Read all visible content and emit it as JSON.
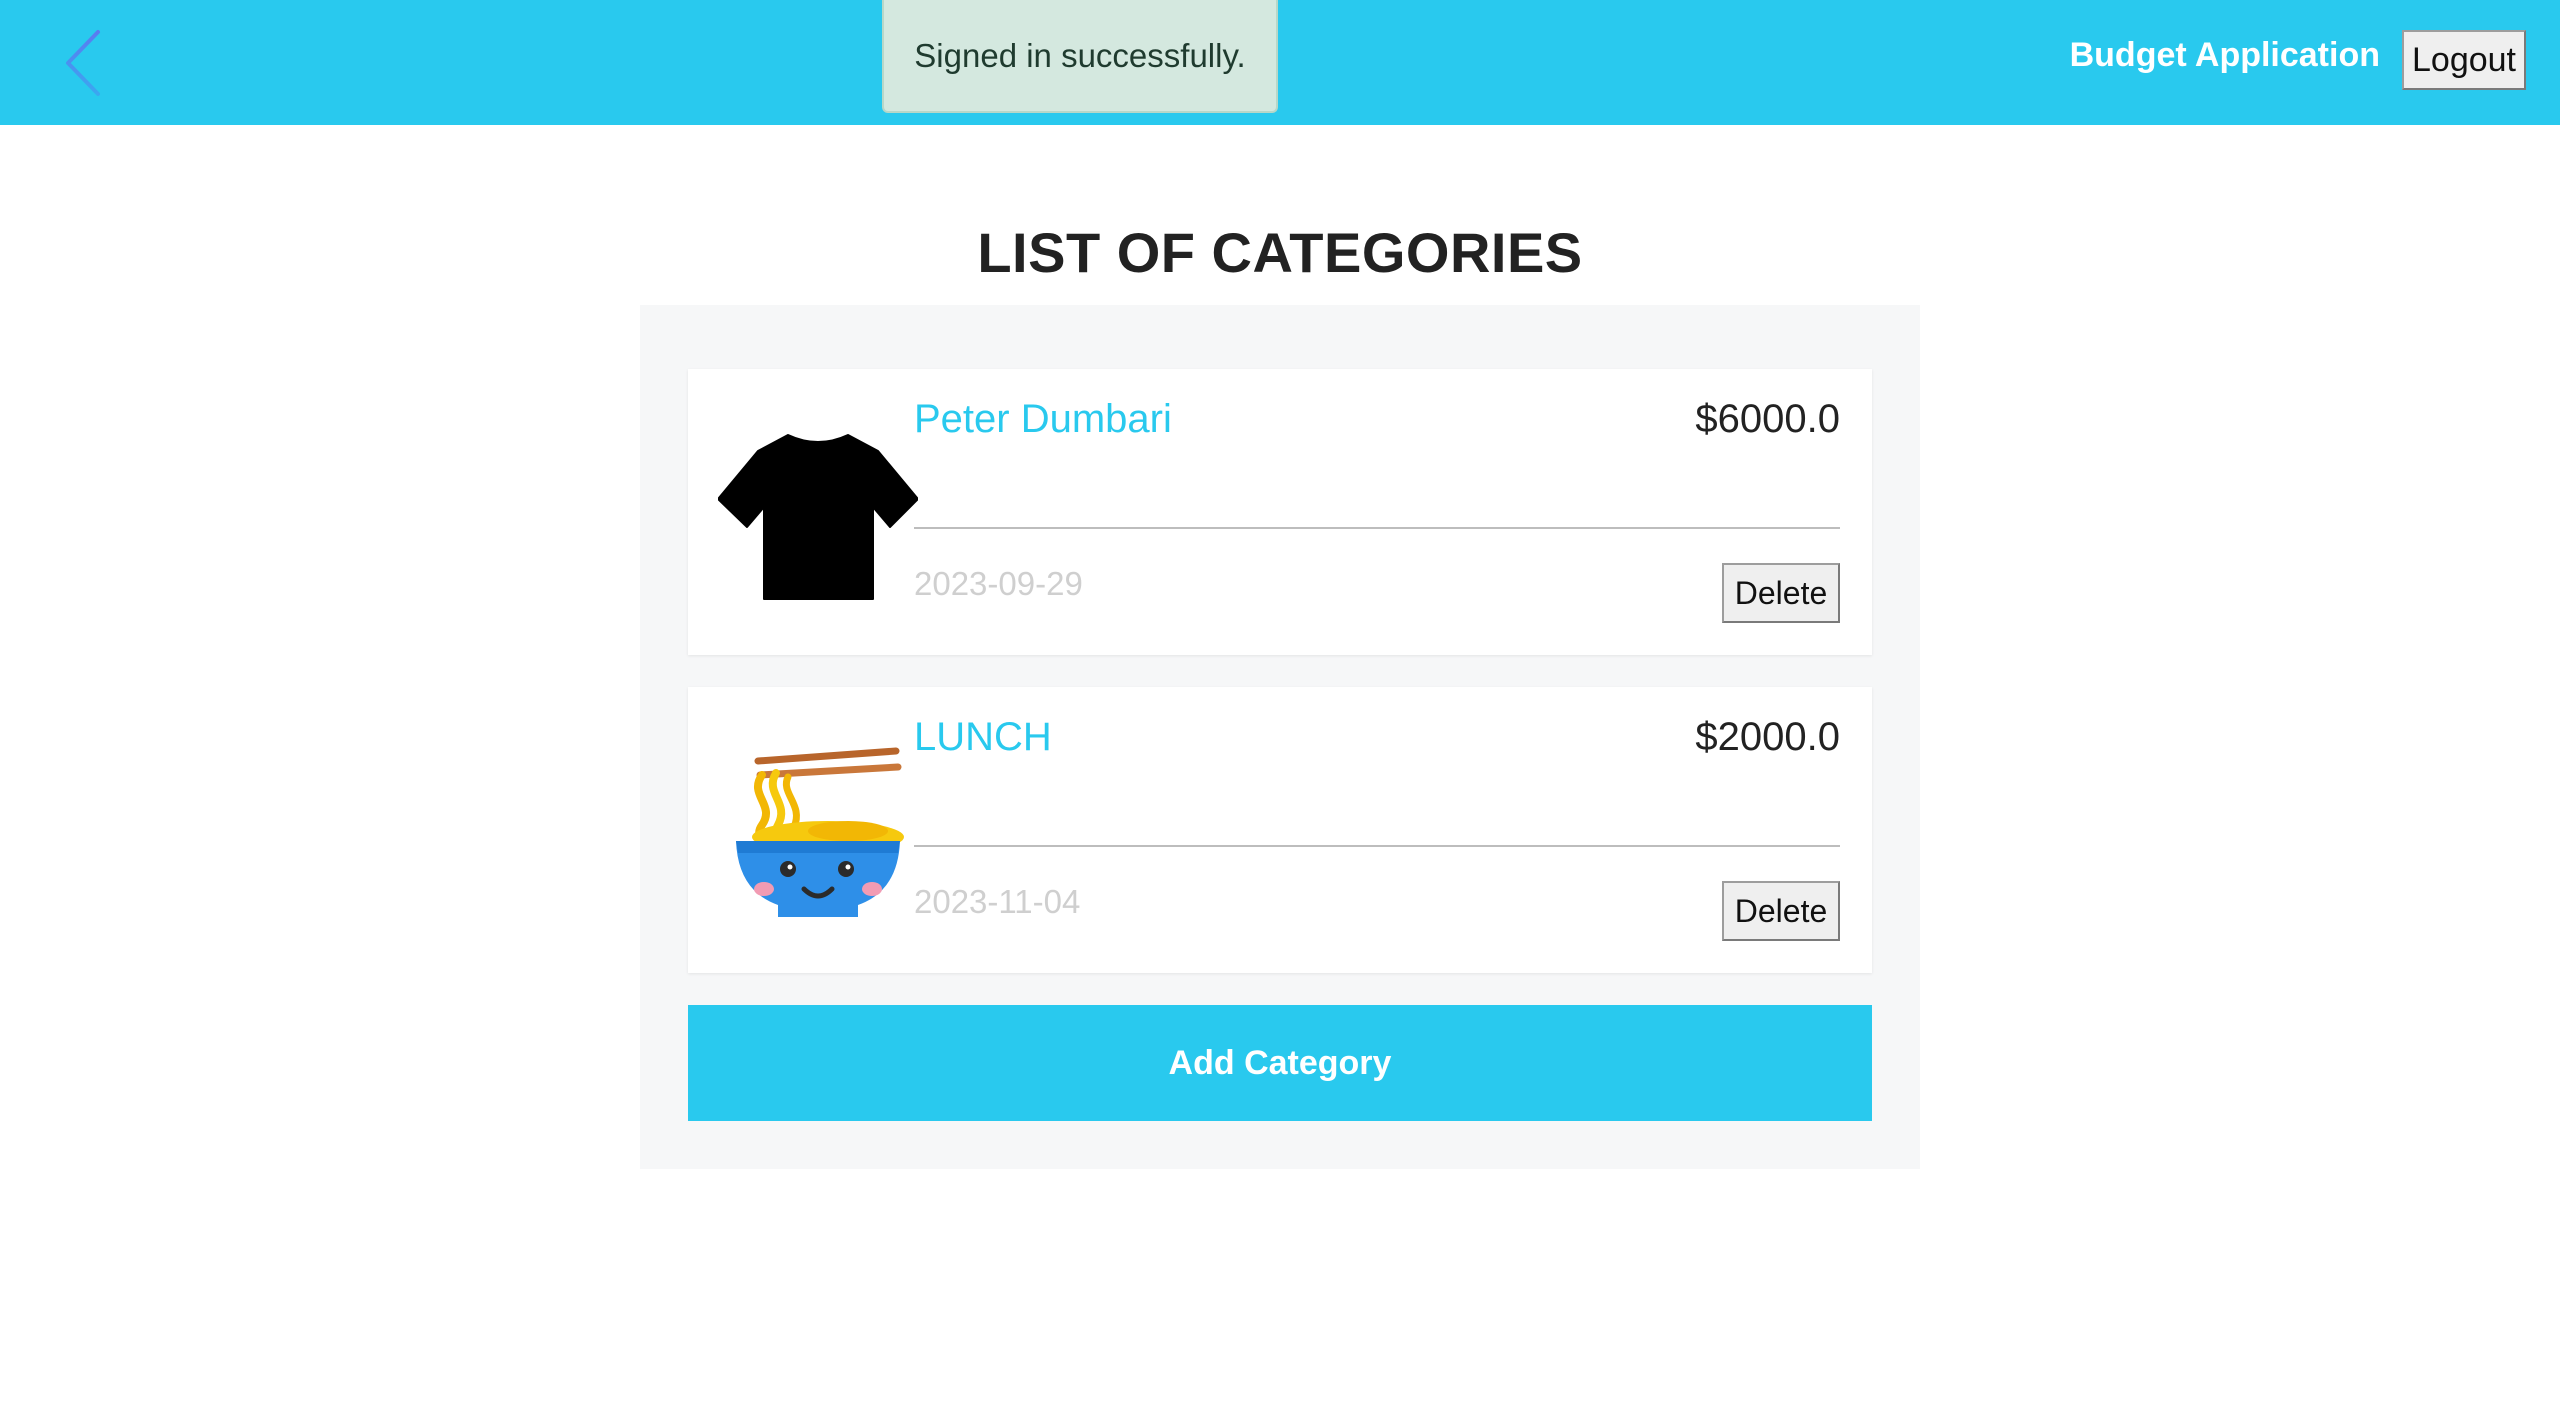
{
  "navbar": {
    "back_icon": "chevron-left-icon",
    "brand": "Budget Application",
    "logout_label": "Logout",
    "background_color": "#29c9ee"
  },
  "toast": {
    "message": "Signed in successfully."
  },
  "main": {
    "title": "LIST OF CATEGORIES",
    "categories": [
      {
        "icon": "t-shirt-icon",
        "name": "Peter Dumbari",
        "amount": "$6000.0",
        "date": "2023-09-29",
        "delete_label": "Delete"
      },
      {
        "icon": "noodle-bowl-icon",
        "name": "LUNCH",
        "amount": "$2000.0",
        "date": "2023-11-04",
        "delete_label": "Delete"
      }
    ],
    "add_label": "Add Category"
  },
  "colors": {
    "accent": "#29c9ee",
    "toast_bg": "#d4e8df",
    "date_text": "#cfcfcf"
  }
}
